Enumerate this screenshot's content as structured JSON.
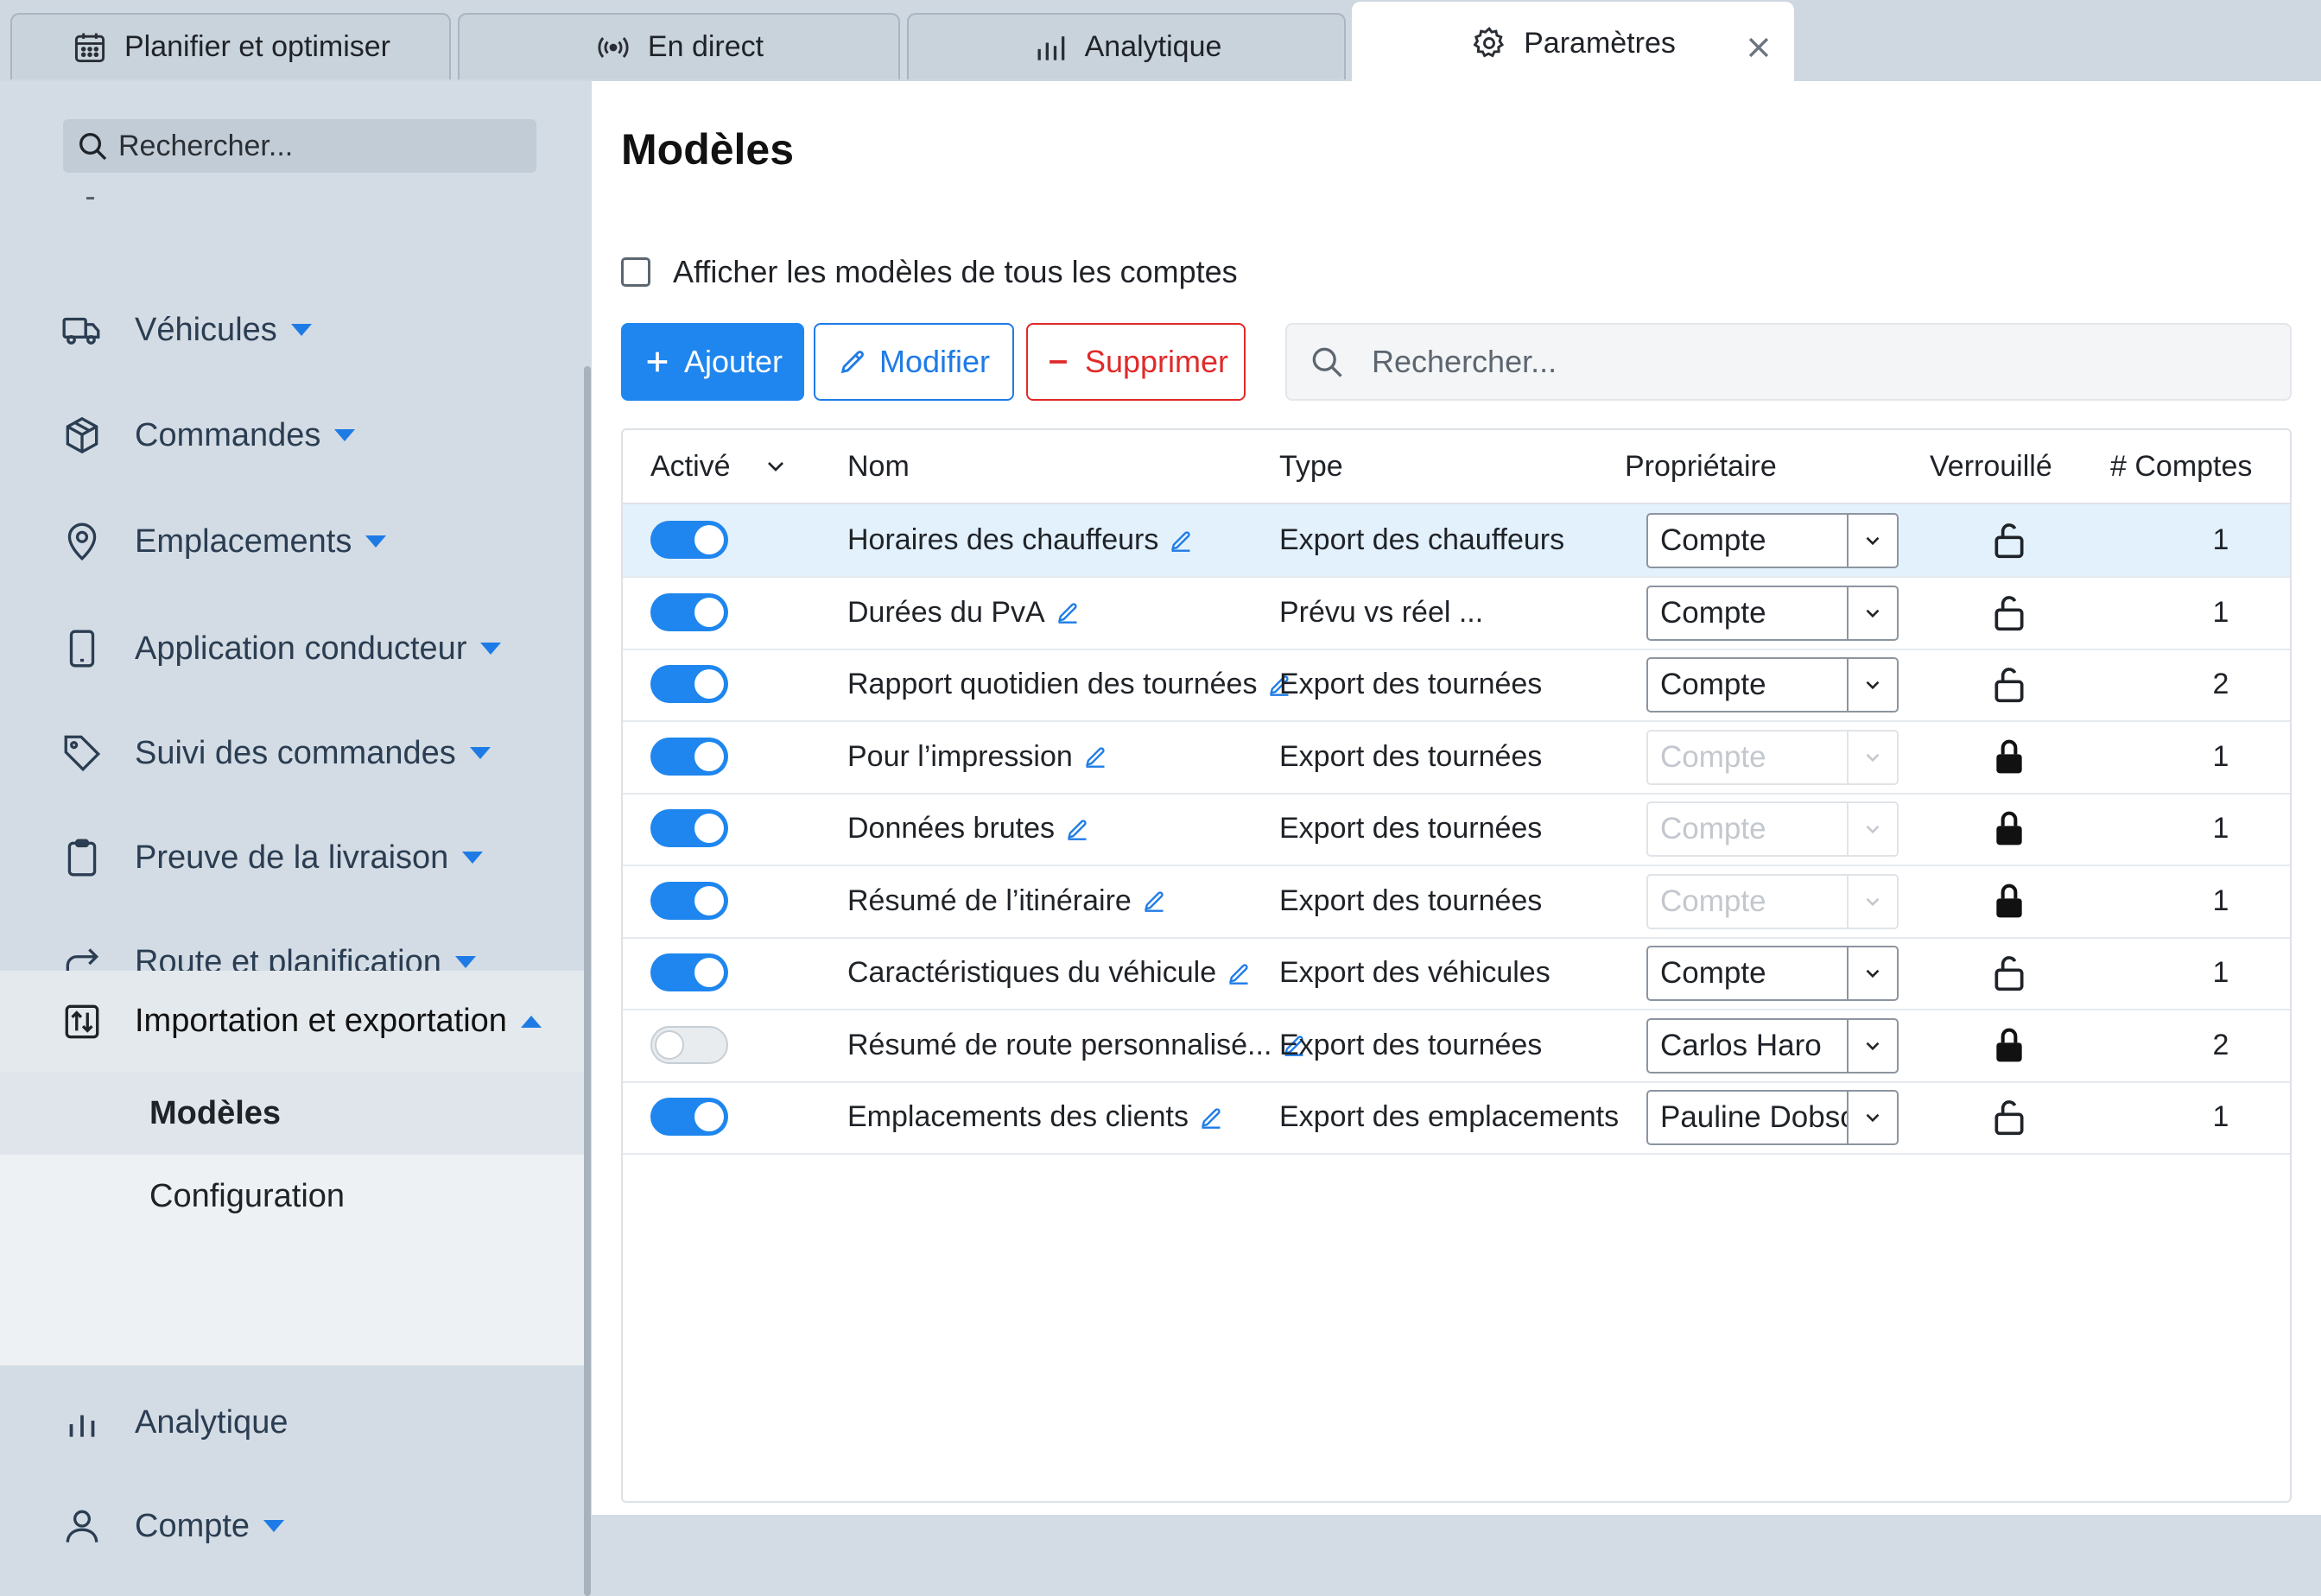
{
  "tabs": [
    {
      "label": "Planifier et optimiser",
      "icon": "calendar-icon",
      "active": false
    },
    {
      "label": "En direct",
      "icon": "broadcast-icon",
      "active": false
    },
    {
      "label": "Analytique",
      "icon": "bar-chart-icon",
      "active": false
    },
    {
      "label": "Paramètres",
      "icon": "gear-icon",
      "active": true
    }
  ],
  "sidebar": {
    "search_placeholder": "Rechercher...",
    "items": [
      {
        "label": "Véhicules",
        "icon": "truck-icon"
      },
      {
        "label": "Commandes",
        "icon": "box-icon"
      },
      {
        "label": "Emplacements",
        "icon": "map-pin-icon"
      },
      {
        "label": "Application conducteur",
        "icon": "phone-icon"
      },
      {
        "label": "Suivi des commandes",
        "icon": "tag-icon"
      },
      {
        "label": "Preuve de la livraison",
        "icon": "clipboard-icon"
      },
      {
        "label": "Route et planification",
        "icon": "route-arrow-icon"
      },
      {
        "label": "Importation et exportation",
        "icon": "import-export-icon"
      },
      {
        "label": "Analytique",
        "icon": "bar-chart-icon"
      },
      {
        "label": "Compte",
        "icon": "user-icon"
      }
    ],
    "submenu": [
      {
        "label": "Modèles",
        "selected": true
      },
      {
        "label": "Configuration",
        "selected": false
      }
    ]
  },
  "main": {
    "title": "Modèles",
    "show_all_label": "Afficher les modèles de tous les comptes",
    "buttons": {
      "add": "Ajouter",
      "edit": "Modifier",
      "delete": "Supprimer"
    },
    "search_placeholder": "Rechercher...",
    "columns": {
      "active": "Activé",
      "name": "Nom",
      "type": "Type",
      "owner": "Propriétaire",
      "locked": "Verrouillé",
      "accounts": "# Comptes"
    },
    "rows": [
      {
        "active": true,
        "name": "Horaires des chauffeurs",
        "type": "Export des chauffeurs",
        "owner": "Compte",
        "owner_disabled": false,
        "locked": false,
        "accounts": "1"
      },
      {
        "active": true,
        "name": "Durées du PvA",
        "type": "Prévu vs réel ...",
        "owner": "Compte",
        "owner_disabled": false,
        "locked": false,
        "accounts": "1"
      },
      {
        "active": true,
        "name": "Rapport quotidien des tournées",
        "type": "Export des tournées",
        "owner": "Compte",
        "owner_disabled": false,
        "locked": false,
        "accounts": "2"
      },
      {
        "active": true,
        "name": "Pour l’impression",
        "type": "Export des tournées",
        "owner": "Compte",
        "owner_disabled": true,
        "locked": true,
        "accounts": "1"
      },
      {
        "active": true,
        "name": "Données brutes",
        "type": "Export des tournées",
        "owner": "Compte",
        "owner_disabled": true,
        "locked": true,
        "accounts": "1"
      },
      {
        "active": true,
        "name": "Résumé de l’itinéraire",
        "type": "Export des tournées",
        "owner": "Compte",
        "owner_disabled": true,
        "locked": true,
        "accounts": "1"
      },
      {
        "active": true,
        "name": "Caractéristiques du véhicule",
        "type": "Export des véhicules",
        "owner": "Compte",
        "owner_disabled": false,
        "locked": false,
        "accounts": "1"
      },
      {
        "active": false,
        "name": "Résumé de route personnalisé...",
        "type": "Export des tournées",
        "owner": "Carlos Haro",
        "owner_disabled": false,
        "locked": true,
        "accounts": "2"
      },
      {
        "active": true,
        "name": "Emplacements des clients",
        "type": "Export des emplacements",
        "owner": "Pauline Dobso",
        "owner_disabled": false,
        "locked": false,
        "accounts": "1"
      }
    ]
  },
  "colors": {
    "accent": "#1e86ee",
    "danger": "#e02a2a",
    "row_highlight": "#e3f1fc",
    "sidebar_bg": "#d3dce4"
  }
}
